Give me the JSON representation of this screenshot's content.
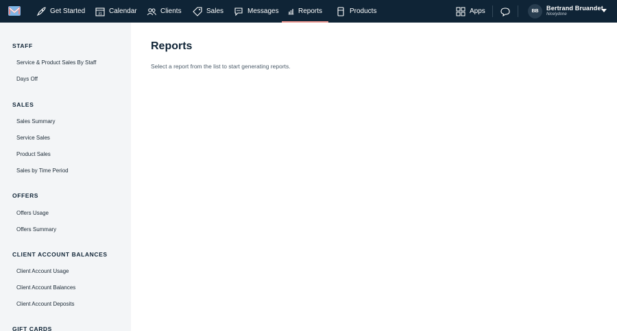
{
  "nav": {
    "items": [
      {
        "label": "Get Started",
        "icon": "rocket-icon"
      },
      {
        "label": "Calendar",
        "icon": "calendar-icon",
        "icon_text": "31"
      },
      {
        "label": "Clients",
        "icon": "users-icon"
      },
      {
        "label": "Sales",
        "icon": "tag-icon"
      },
      {
        "label": "Messages",
        "icon": "chat-icon"
      },
      {
        "label": "Reports",
        "icon": "chart-icon",
        "active": true
      },
      {
        "label": "Products",
        "icon": "box-icon"
      }
    ],
    "apps_label": "Apps",
    "user": {
      "initials": "BB",
      "name": "Bertrand Bruandet",
      "org": "Nicelydone"
    },
    "active_color": "#e9958f",
    "bar_color": "#0f2436"
  },
  "sidebar": {
    "sections": [
      {
        "title": "STAFF",
        "items": [
          "Service & Product Sales By Staff",
          "Days Off"
        ]
      },
      {
        "title": "SALES",
        "items": [
          "Sales Summary",
          "Service Sales",
          "Product Sales",
          "Sales by Time Period"
        ]
      },
      {
        "title": "OFFERS",
        "items": [
          "Offers Usage",
          "Offers Summary"
        ]
      },
      {
        "title": "CLIENT ACCOUNT BALANCES",
        "items": [
          "Client Account Usage",
          "Client Account Balances",
          "Client Account Deposits"
        ]
      },
      {
        "title": "GIFT CARDS",
        "items": []
      }
    ]
  },
  "main": {
    "title": "Reports",
    "subtitle": "Select a report from the list to start generating reports."
  }
}
